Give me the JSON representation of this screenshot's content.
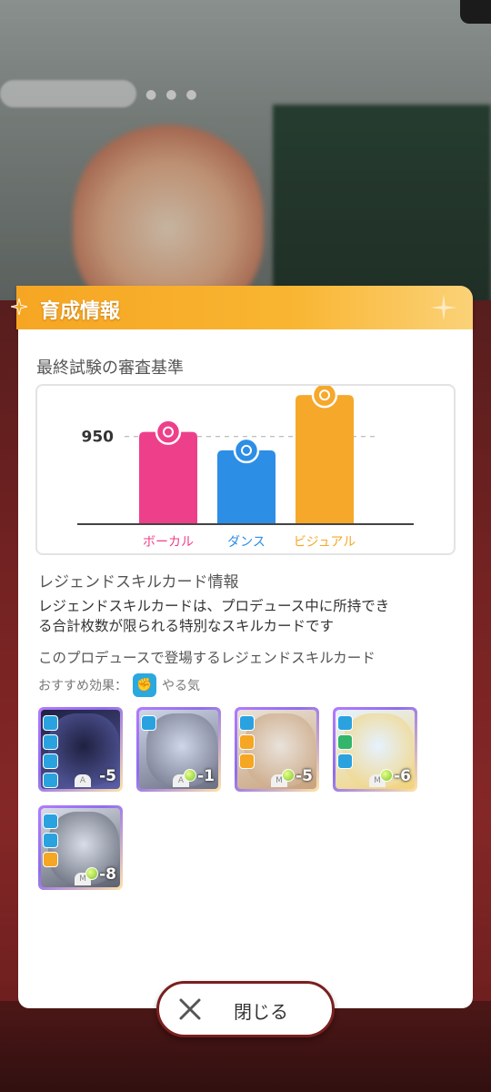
{
  "panel": {
    "title": "育成情報"
  },
  "exam": {
    "section_title": "最終試験の審査基準",
    "reference_label": "950"
  },
  "chart_data": {
    "type": "bar",
    "title": "",
    "categories": [
      "ボーカル",
      "ダンス",
      "ビジュアル"
    ],
    "values": [
      1000,
      800,
      1400
    ],
    "reference_line": 950,
    "ylim": [
      0,
      1500
    ],
    "colors": [
      "#ee3f8a",
      "#2d8ee6",
      "#f6a82a"
    ],
    "icons": [
      "microphone-icon",
      "shoe-icon",
      "palette-icon"
    ]
  },
  "legend_info": {
    "section_title": "レジェンドスキルカード情報",
    "description_line1": "レジェンドスキルカードは、プロデュース中に所持でき",
    "description_line2": "る合計枚数が限られる特別なスキルカードです",
    "appear_title": "このプロデュースで登場するレジェンドスキルカード",
    "recommended_label": "おすすめ効果：",
    "recommended_value": "やる気"
  },
  "cards": [
    {
      "cost": "-5",
      "rarity": "A",
      "cost_type": "plain",
      "art": [
        "#1f2140",
        "#5a5fa8"
      ],
      "badges": [
        "blue",
        "blue",
        "blue",
        "blue"
      ]
    },
    {
      "cost": "-1",
      "rarity": "A",
      "cost_type": "green",
      "art": [
        "#cfd6e8",
        "#6b6f84"
      ],
      "badges": [
        "blue"
      ]
    },
    {
      "cost": "-5",
      "rarity": "M",
      "cost_type": "green",
      "art": [
        "#e9e2da",
        "#c8a27c"
      ],
      "badges": [
        "blue",
        "orange",
        "orange"
      ]
    },
    {
      "cost": "-6",
      "rarity": "M",
      "cost_type": "green",
      "art": [
        "#e6f2ff",
        "#f2d37a"
      ],
      "badges": [
        "blue",
        "green",
        "blue"
      ]
    },
    {
      "cost": "-8",
      "rarity": "M",
      "cost_type": "green",
      "art": [
        "#d8dde8",
        "#5c6170"
      ],
      "badges": [
        "blue",
        "blue",
        "orange"
      ]
    }
  ],
  "footer": {
    "close_label": "閉じる"
  },
  "colors": {
    "header": "#f6a623",
    "vocal": "#ee3f8a",
    "dance": "#2d8ee6",
    "visual": "#f6a82a"
  }
}
